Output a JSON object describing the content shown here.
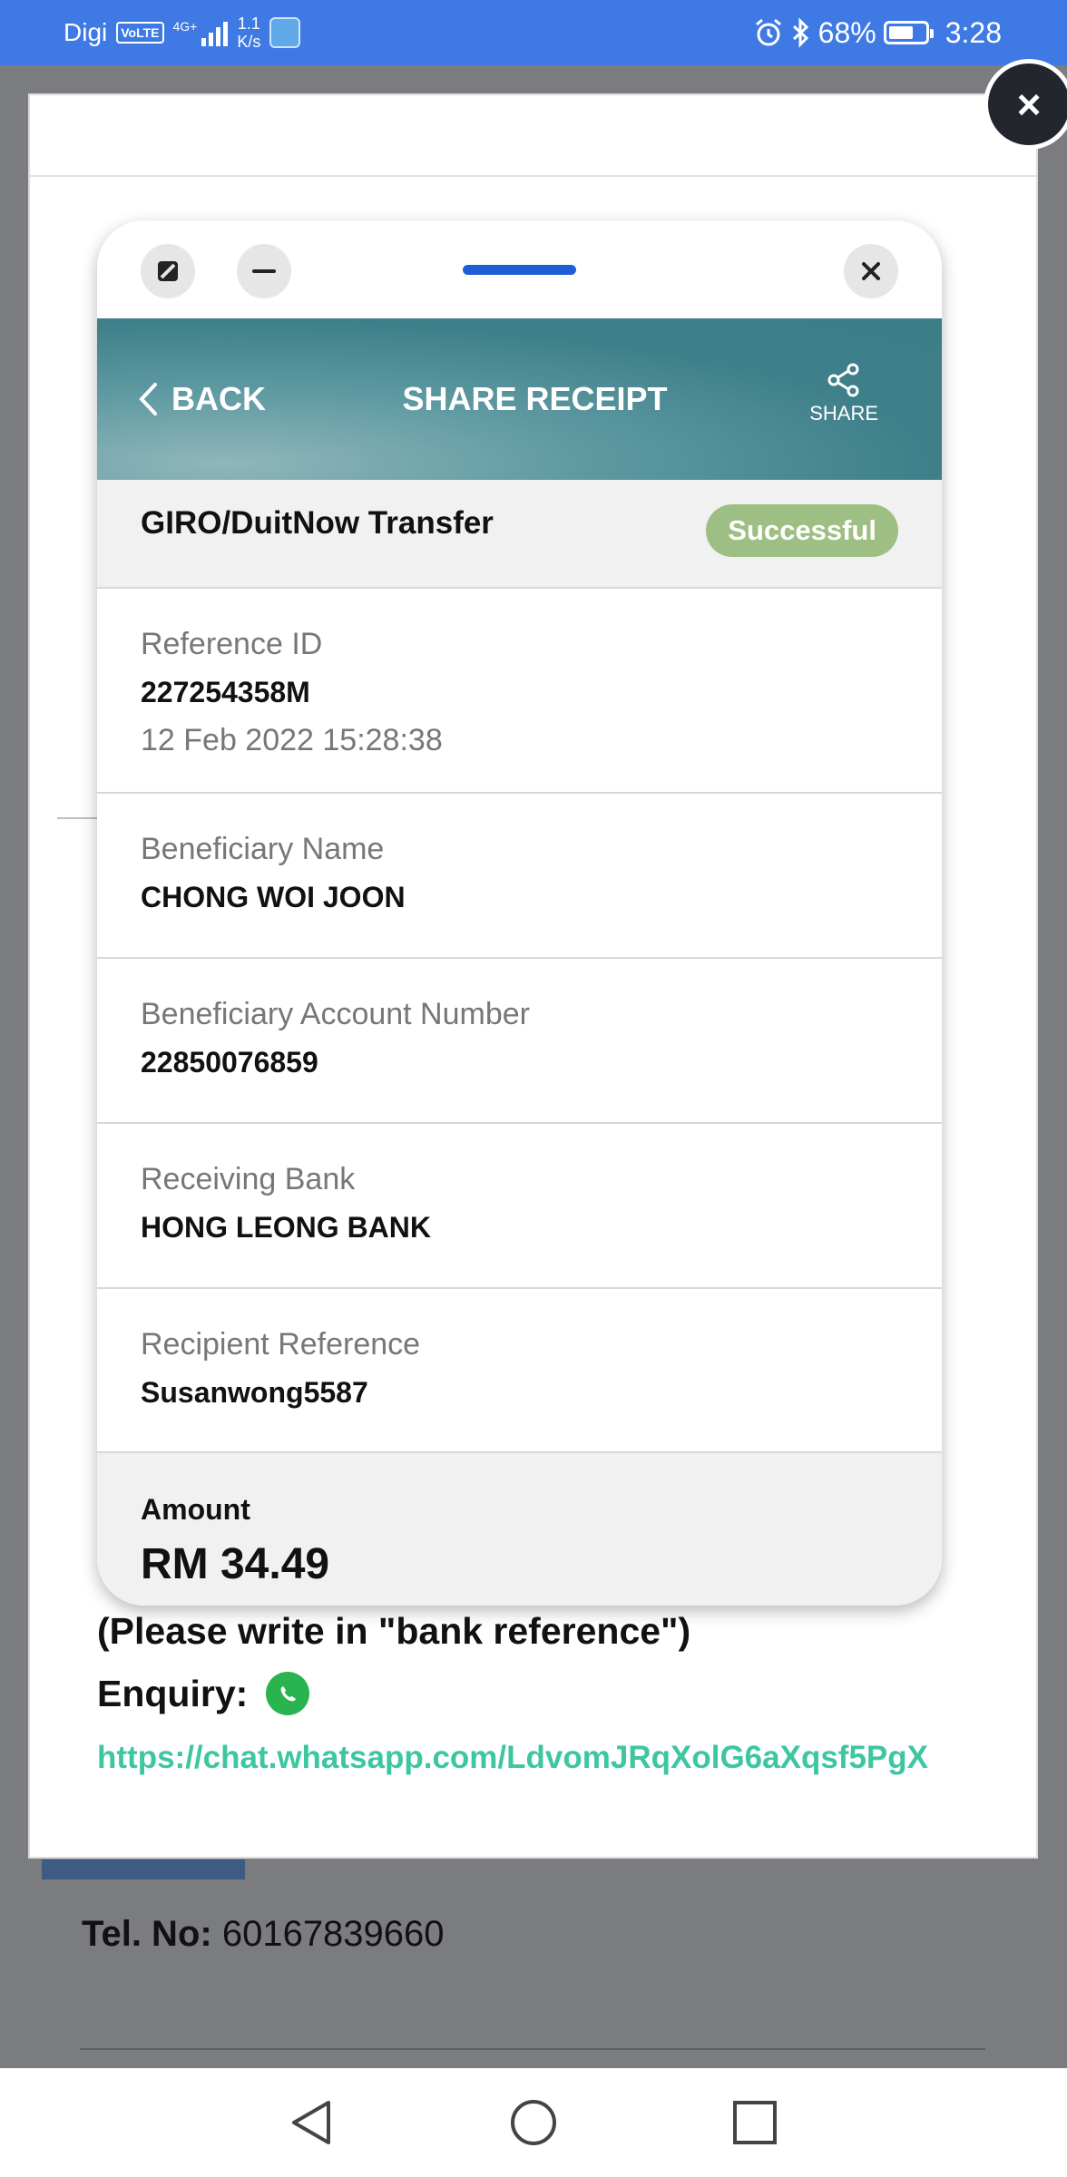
{
  "status_bar": {
    "carrier": "Digi",
    "volte": "VoLTE",
    "network": "4G+",
    "speed_value": "1.1",
    "speed_unit": "K/s",
    "battery": "68%",
    "battery_level": 0.68,
    "time": "3:28"
  },
  "background_page": {
    "tel_label": "Tel. No:",
    "tel_value": "60167839660"
  },
  "modal": {
    "close_label": "×"
  },
  "receipt": {
    "back_label": "BACK",
    "title": "SHARE RECEIPT",
    "share_label": "SHARE",
    "transaction_type": "GIRO/DuitNow Transfer",
    "status": "Successful",
    "fields": [
      {
        "label": "Reference ID",
        "value": "227254358M",
        "sub": "12 Feb 2022 15:28:38"
      },
      {
        "label": "Beneficiary Name",
        "value": "CHONG WOI JOON"
      },
      {
        "label": "Beneficiary Account Number",
        "value": "22850076859"
      },
      {
        "label": "Receiving Bank",
        "value": "HONG LEONG BANK"
      },
      {
        "label": "Recipient Reference",
        "value": "Susanwong5587"
      }
    ],
    "amount_label": "Amount",
    "amount_value": "RM 34.49"
  },
  "note": {
    "text": "(Please write in \"bank reference\")",
    "enquiry_label": "Enquiry:",
    "link": "https://chat.whatsapp.com/LdvomJRqXolG6aXqsf5PgX"
  },
  "colors": {
    "status_bar": "#3f7ae4",
    "header_teal": "#3e7f89",
    "success_green": "#9dbf83",
    "link_teal": "#3ec6a1",
    "whatsapp_green": "#2ab44f"
  }
}
